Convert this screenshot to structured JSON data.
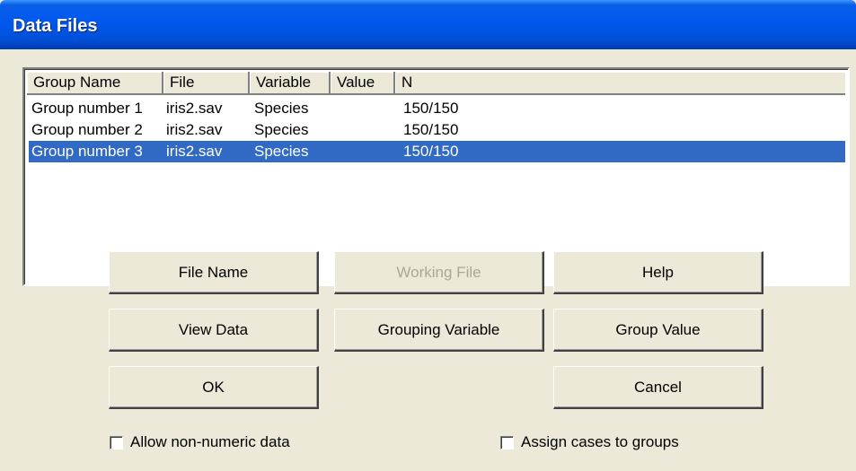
{
  "window": {
    "title": "Data Files"
  },
  "table": {
    "columns": [
      "Group Name",
      "File",
      "Variable",
      "Value",
      "N"
    ],
    "rows": [
      {
        "group": "Group number 1",
        "file": "iris2.sav",
        "variable": "Species",
        "value": "",
        "n": "150/150",
        "selected": false
      },
      {
        "group": "Group number 2",
        "file": "iris2.sav",
        "variable": "Species",
        "value": "",
        "n": "150/150",
        "selected": false
      },
      {
        "group": "Group number 3",
        "file": "iris2.sav",
        "variable": "Species",
        "value": "",
        "n": "150/150",
        "selected": true
      }
    ]
  },
  "buttons": {
    "file_name": "File Name",
    "working_file": "Working File",
    "help": "Help",
    "view_data": "View Data",
    "grouping_variable": "Grouping Variable",
    "group_value": "Group Value",
    "ok": "OK",
    "cancel": "Cancel"
  },
  "checkboxes": {
    "allow_non_numeric": {
      "label": "Allow non-numeric data",
      "checked": false
    },
    "assign_cases": {
      "label": "Assign cases to groups",
      "checked": false
    }
  },
  "colors": {
    "title_bar": "#0058ee",
    "selection": "#316ac5",
    "dialog_bg": "#ece9d8"
  }
}
